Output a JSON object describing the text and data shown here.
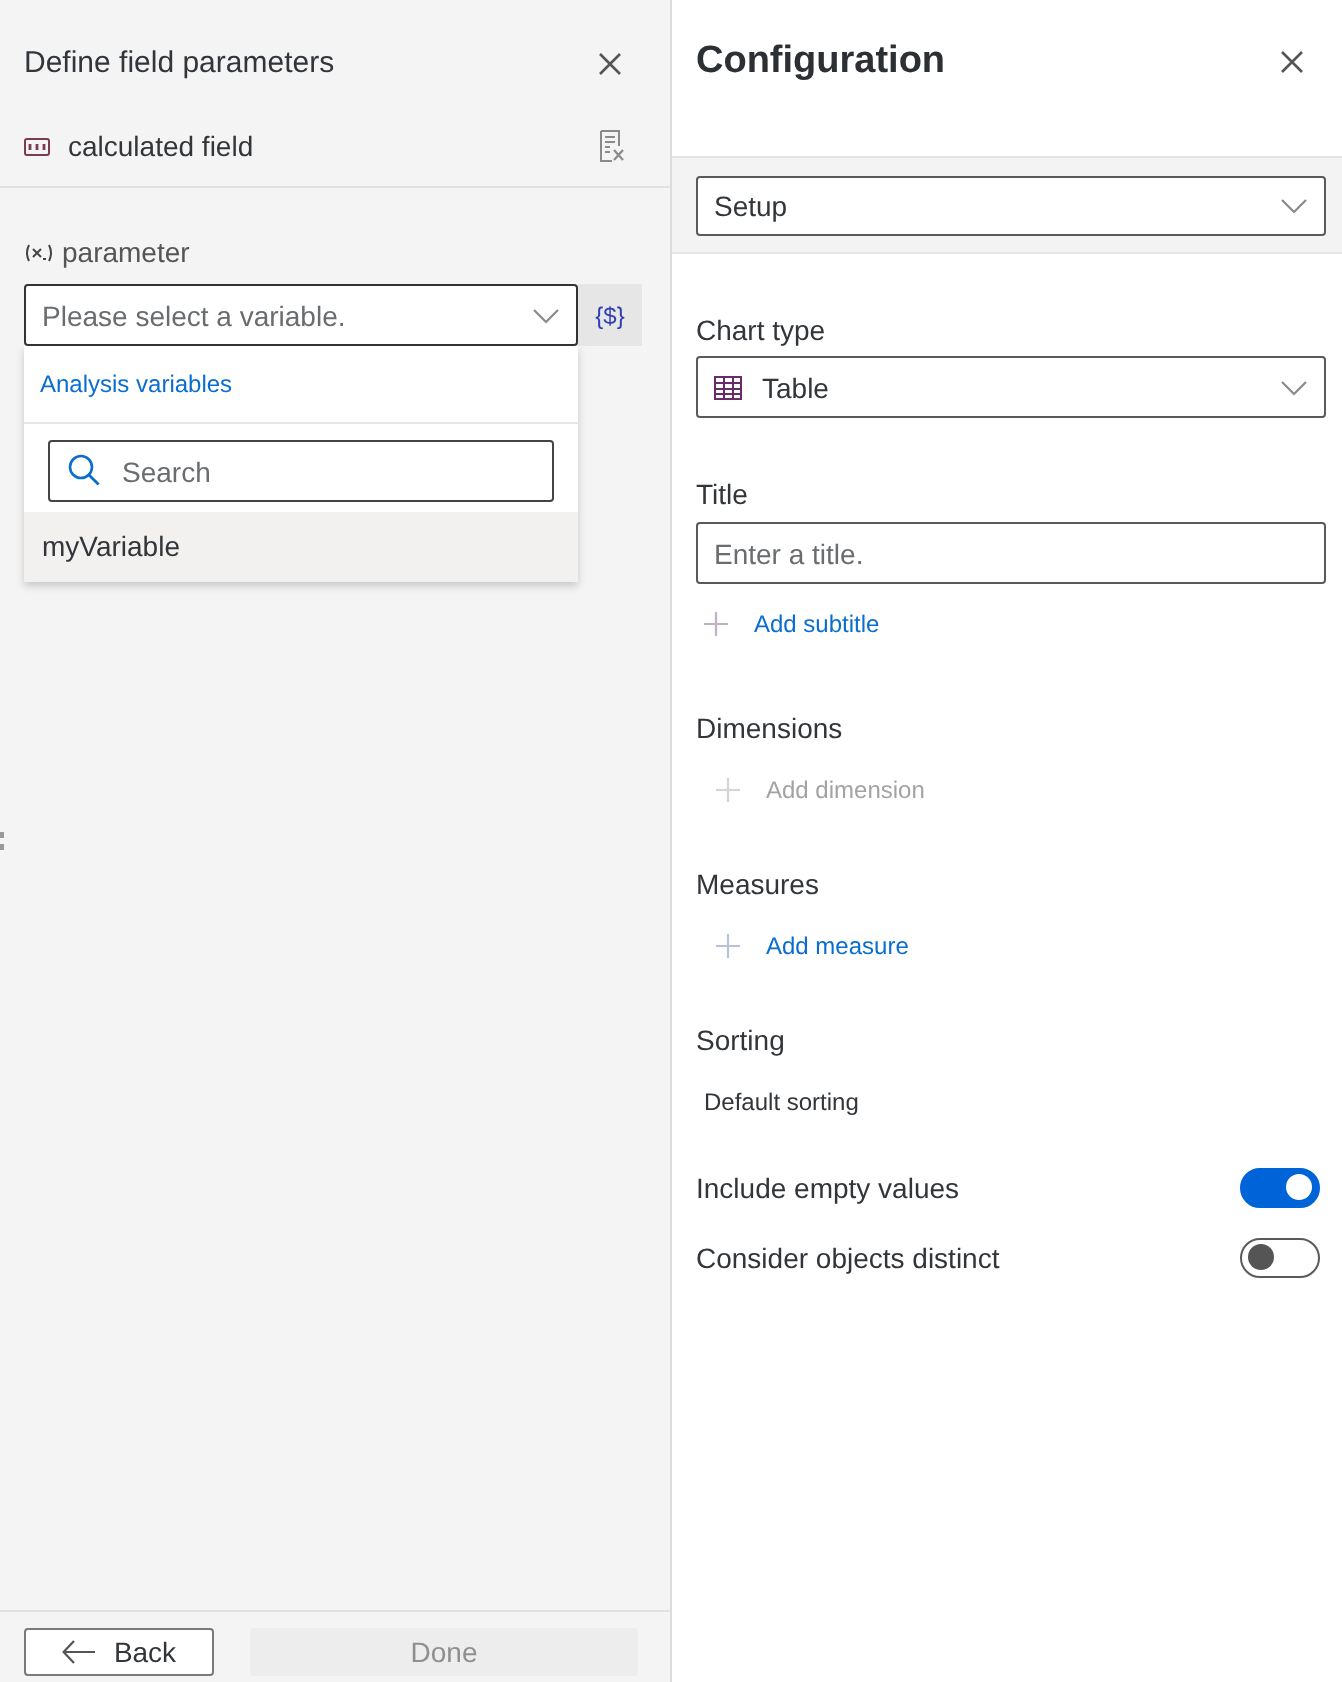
{
  "left_panel": {
    "title": "Define field parameters",
    "field": {
      "name": "calculated field"
    },
    "parameter": {
      "label": "parameter",
      "placeholder": "Please select a variable.",
      "variable_button": "{$}",
      "dropdown": {
        "open": true,
        "group_link": "Analysis variables",
        "search": {
          "placeholder": "Search"
        },
        "items": [
          {
            "label": "myVariable",
            "highlighted": true
          }
        ]
      }
    },
    "footer": {
      "buttons": [
        {
          "kind": "back",
          "label": "Back",
          "disabled": false
        },
        {
          "kind": "primary",
          "label": "Done",
          "disabled": true
        }
      ]
    }
  },
  "right_panel": {
    "title": "Configuration",
    "view_select": {
      "value": "Setup"
    },
    "sections": [
      {
        "kind": "select",
        "label": "Chart type",
        "value": "Table"
      },
      {
        "kind": "input",
        "label": "Title",
        "placeholder": "Enter a title.",
        "action": {
          "label": "Add subtitle",
          "disabled": false
        }
      },
      {
        "kind": "list",
        "label": "Dimensions",
        "action": {
          "label": "Add dimension",
          "disabled": true
        }
      },
      {
        "kind": "list",
        "label": "Measures",
        "action": {
          "label": "Add measure",
          "disabled": false
        }
      },
      {
        "kind": "text",
        "label": "Sorting",
        "value": "Default sorting"
      }
    ],
    "toggles": [
      {
        "label": "Include empty values",
        "on": true
      },
      {
        "label": "Consider objects distinct",
        "on": false
      }
    ]
  }
}
